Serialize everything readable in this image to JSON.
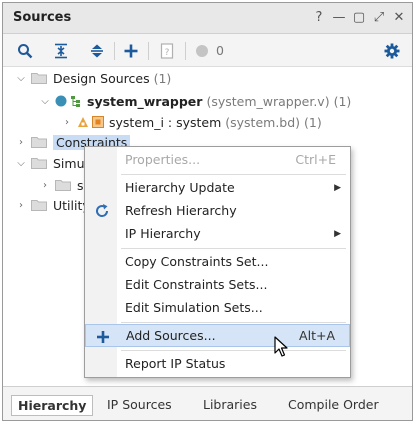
{
  "window": {
    "title": "Sources",
    "buttons": [
      "?",
      "—",
      "▢",
      "⤢",
      "✕"
    ]
  },
  "toolbar": {
    "icons": [
      "search-icon",
      "collapse-all-icon",
      "expand-all-icon",
      "add-icon",
      "document-icon",
      "status-dot-icon",
      "gear-icon"
    ],
    "count": "0"
  },
  "tree": {
    "design_sources": {
      "label": "Design Sources",
      "count": "(1)"
    },
    "system_wrapper": {
      "label": "system_wrapper",
      "file": "(system_wrapper.v)",
      "count": "(1)"
    },
    "system_i": {
      "label": "system_i : system",
      "file": "(system.bd)",
      "count": "(1)"
    },
    "constraints": {
      "label": "Constraints"
    },
    "simulation": {
      "label": "Simula"
    },
    "sim_child": {
      "label": "si"
    },
    "utility": {
      "label": "Utility"
    }
  },
  "context_menu": {
    "properties": {
      "label": "Properties...",
      "shortcut": "Ctrl+E"
    },
    "hierarchy_update": {
      "label": "Hierarchy Update"
    },
    "refresh_hierarchy": {
      "label": "Refresh Hierarchy"
    },
    "ip_hierarchy": {
      "label": "IP Hierarchy"
    },
    "copy_constraints": {
      "label": "Copy Constraints Set..."
    },
    "edit_constraints": {
      "label": "Edit Constraints Sets..."
    },
    "edit_simulation": {
      "label": "Edit Simulation Sets..."
    },
    "add_sources": {
      "label": "Add Sources...",
      "shortcut": "Alt+A"
    },
    "report_ip_status": {
      "label": "Report IP Status"
    }
  },
  "tabs": [
    "Hierarchy",
    "IP Sources",
    "Libraries",
    "Compile Order"
  ],
  "colors": {
    "accent": "#2f6db5",
    "selection": "#d5e4f6",
    "highlight": "#c8ddf5",
    "ok_dot": "#3a8fb7"
  }
}
